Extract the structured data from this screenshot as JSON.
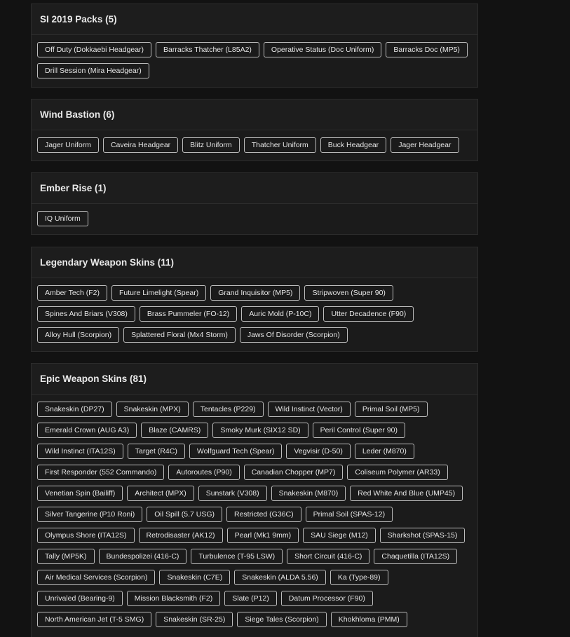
{
  "sections": [
    {
      "title": "SI 2019 Packs (5)",
      "items": [
        "Off Duty (Dokkaebi Headgear)",
        "Barracks Thatcher (L85A2)",
        "Operative Status (Doc Uniform)",
        "Barracks Doc (MP5)",
        "Drill Session (Mira Headgear)"
      ]
    },
    {
      "title": "Wind Bastion (6)",
      "items": [
        "Jager Uniform",
        "Caveira Headgear",
        "Blitz Uniform",
        "Thatcher Uniform",
        "Buck Headgear",
        "Jager Headgear"
      ]
    },
    {
      "title": "Ember Rise (1)",
      "items": [
        "IQ Uniform"
      ]
    },
    {
      "title": "Legendary Weapon Skins (11)",
      "items": [
        "Amber Tech (F2)",
        "Future Limelight (Spear)",
        "Grand Inquisitor (MP5)",
        "Stripwoven (Super 90)",
        "Spines And Briars (V308)",
        "Brass Pummeler (FO-12)",
        "Auric Mold (P-10C)",
        "Utter Decadence (F90)",
        "Alloy Hull (Scorpion)",
        "Splattered Floral (Mx4 Storm)",
        "Jaws Of Disorder (Scorpion)"
      ]
    },
    {
      "title": "Epic Weapon Skins (81)",
      "items": [
        "Snakeskin (DP27)",
        "Snakeskin (MPX)",
        "Tentacles (P229)",
        "Wild Instinct (Vector)",
        "Primal Soil (MP5)",
        "Emerald Crown (AUG A3)",
        "Blaze (CAMRS)",
        "Smoky Murk (SIX12 SD)",
        "Peril Control (Super 90)",
        "Wild Instinct (ITA12S)",
        "Target (R4C)",
        "Wolfguard Tech (Spear)",
        "Vegvisir (D-50)",
        "Leder (M870)",
        "First Responder (552 Commando)",
        "Autoroutes (P90)",
        "Canadian Chopper (MP7)",
        "Coliseum Polymer (AR33)",
        "Venetian Spin (Bailiff)",
        "Architect (MPX)",
        "Sunstark (V308)",
        "Snakeskin (M870)",
        "Red White And Blue (UMP45)",
        "Silver Tangerine (P10 Roni)",
        "Oil Spill (5.7 USG)",
        "Restricted (G36C)",
        "Primal Soil (SPAS-12)",
        "Olympus Shore (ITA12S)",
        "Retrodisaster (AK12)",
        "Pearl (Mk1 9mm)",
        "SAU Siege (M12)",
        "Sharkshot (SPAS-15)",
        "Tally (MP5K)",
        "Bundespolizei (416-C)",
        "Turbulence (T-95 LSW)",
        "Short Circuit (416-C)",
        "Chaquetilla (ITA12S)",
        "Air Medical Services (Scorpion)",
        "Snakeskin (C7E)",
        "Snakeskin (ALDA 5.56)",
        "Ka (Type-89)",
        "Unrivaled (Bearing-9)",
        "Mission Blacksmith (F2)",
        "Slate (P12)",
        "Datum Processor (F90)",
        "North American Jet (T-5 SMG)",
        "Snakeskin (SR-25)",
        "Siege Tales (Scorpion)",
        "Khokhloma (PMM)"
      ]
    }
  ]
}
